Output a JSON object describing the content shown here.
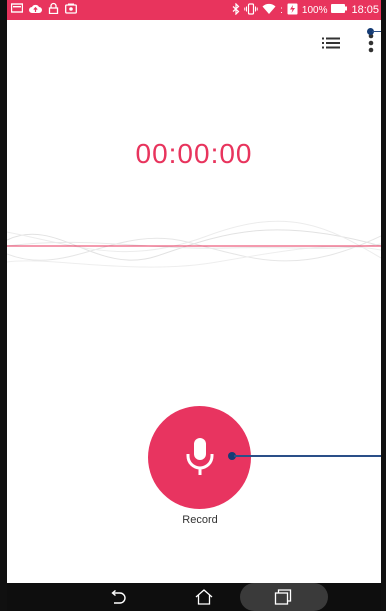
{
  "status_bar": {
    "battery_percent": "100%",
    "time": "18:05",
    "left_icons": [
      "message-icon",
      "cloud-upload-icon",
      "lock-icon",
      "screenshot-icon"
    ],
    "right_icons": [
      "bluetooth-icon",
      "vibrate-icon",
      "wifi-icon",
      "battery-icon"
    ]
  },
  "toolbar": {
    "icons": [
      "recording-list-icon",
      "more-options-icon"
    ]
  },
  "recorder": {
    "timer": "00:00:00",
    "record_label": "Record"
  },
  "nav_bar": {
    "icons": [
      "back-icon",
      "home-icon",
      "recent-apps-icon"
    ]
  },
  "colors": {
    "accent": "#e8345d",
    "callout": "#153c75",
    "nav_bar": "#0e0e0e"
  }
}
